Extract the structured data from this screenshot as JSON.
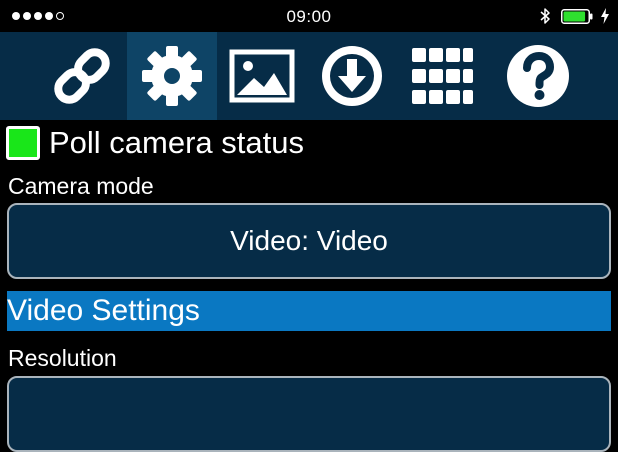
{
  "status_bar": {
    "time": "09:00",
    "signal_bars_filled": 4,
    "signal_bars_total": 5,
    "battery_level": 0.9,
    "bluetooth_icon": "bluetooth-icon",
    "charging_icon": "charging-bolt-icon"
  },
  "toolbar": {
    "active_index": 1,
    "items": [
      {
        "icon": "link-icon",
        "active": false
      },
      {
        "icon": "gear-icon",
        "active": true
      },
      {
        "icon": "image-icon",
        "active": false
      },
      {
        "icon": "download-icon",
        "active": false
      },
      {
        "icon": "grid-icon",
        "active": false
      },
      {
        "icon": "help-icon",
        "active": false
      }
    ]
  },
  "settings": {
    "poll_camera_status": {
      "label": "Poll camera status",
      "checked": true
    },
    "camera_mode": {
      "label": "Camera mode",
      "value": "Video: Video"
    },
    "section_title": "Video Settings",
    "resolution": {
      "label": "Resolution"
    }
  },
  "colors": {
    "toolbar_bg": "#062c47",
    "toolbar_active_bg": "#0e4466",
    "section_header_bg": "#0a78c2",
    "checkbox_checked": "#19e619",
    "battery_fill": "#2fe02f"
  }
}
